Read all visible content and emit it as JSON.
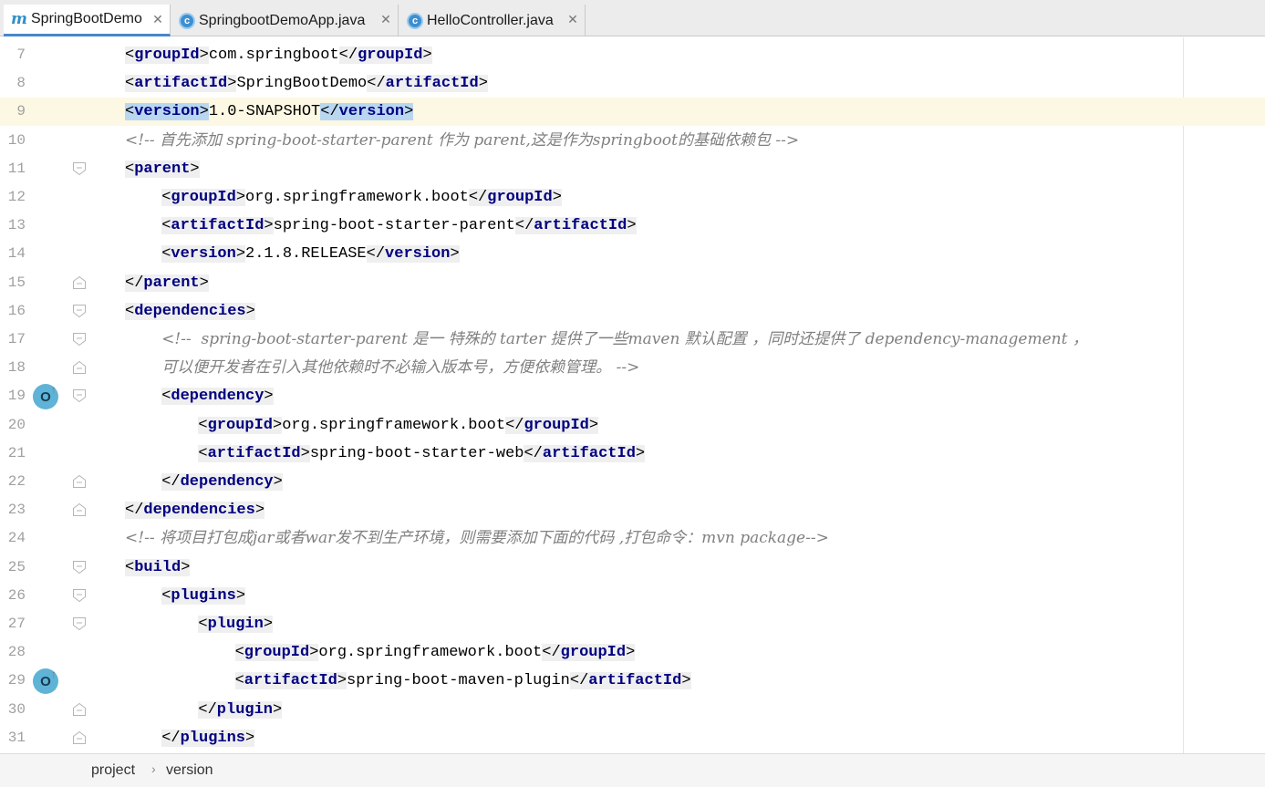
{
  "tabs": [
    {
      "label": "SpringBootDemo",
      "icon": "maven-m-icon",
      "active": true
    },
    {
      "label": "SpringbootDemoApp.java",
      "icon": "java-class-icon",
      "active": false
    },
    {
      "label": "HelloController.java",
      "icon": "java-class-icon",
      "active": false
    }
  ],
  "colors": {
    "tag_name": "#000080",
    "comment": "#808080",
    "current_line": "#fcf8e3",
    "tag_highlight": "#b9d7f1",
    "line_number": "#a0a0a0",
    "tab_underline": "#4a86c8"
  },
  "editor": {
    "current_line": 9,
    "lines": [
      {
        "n": "7",
        "segs": [
          [
            "o",
            "<"
          ],
          [
            "t",
            "groupId"
          ],
          [
            "o",
            ">"
          ],
          [
            "x",
            "com.springboot"
          ],
          [
            "o",
            "</"
          ],
          [
            "t",
            "groupId"
          ],
          [
            "o",
            ">"
          ]
        ]
      },
      {
        "n": "8",
        "segs": [
          [
            "o",
            "<"
          ],
          [
            "t",
            "artifactId"
          ],
          [
            "o",
            ">"
          ],
          [
            "x",
            "SpringBootDemo"
          ],
          [
            "o",
            "</"
          ],
          [
            "t",
            "artifactId"
          ],
          [
            "o",
            ">"
          ]
        ]
      },
      {
        "n": "9",
        "segs": [
          [
            "o",
            "<"
          ],
          [
            "t",
            "version"
          ],
          [
            "o",
            ">"
          ],
          [
            "x",
            "1.0-SNAPSHOT"
          ],
          [
            "o",
            "</"
          ],
          [
            "t",
            "version"
          ],
          [
            "o",
            ">"
          ]
        ]
      },
      {
        "n": "10",
        "segs": [
          [
            "c",
            "<!-- 首先添加 spring-boot-starter-parent 作为 parent,这是作为springboot的基础依赖包 -->"
          ]
        ]
      },
      {
        "n": "11",
        "segs": [
          [
            "o",
            "<"
          ],
          [
            "t",
            "parent"
          ],
          [
            "o",
            ">"
          ]
        ]
      },
      {
        "n": "12",
        "segs": [
          [
            "o",
            "<"
          ],
          [
            "t",
            "groupId"
          ],
          [
            "o",
            ">"
          ],
          [
            "x",
            "org.springframework.boot"
          ],
          [
            "o",
            "</"
          ],
          [
            "t",
            "groupId"
          ],
          [
            "o",
            ">"
          ]
        ]
      },
      {
        "n": "13",
        "segs": [
          [
            "o",
            "<"
          ],
          [
            "t",
            "artifactId"
          ],
          [
            "o",
            ">"
          ],
          [
            "x",
            "spring-boot-starter-parent"
          ],
          [
            "o",
            "</"
          ],
          [
            "t",
            "artifactId"
          ],
          [
            "o",
            ">"
          ]
        ]
      },
      {
        "n": "14",
        "segs": [
          [
            "o",
            "<"
          ],
          [
            "t",
            "version"
          ],
          [
            "o",
            ">"
          ],
          [
            "x",
            "2.1.8.RELEASE"
          ],
          [
            "o",
            "</"
          ],
          [
            "t",
            "version"
          ],
          [
            "o",
            ">"
          ]
        ]
      },
      {
        "n": "15",
        "segs": [
          [
            "o",
            "</"
          ],
          [
            "t",
            "parent"
          ],
          [
            "o",
            ">"
          ]
        ]
      },
      {
        "n": "16",
        "segs": [
          [
            "o",
            "<"
          ],
          [
            "t",
            "dependencies"
          ],
          [
            "o",
            ">"
          ]
        ]
      },
      {
        "n": "17",
        "segs": [
          [
            "c",
            "<!--  spring-boot-starter-parent 是一 特殊的 tarter 提供了一些maven 默认配置 ，同时还提供了 dependency-management ，"
          ]
        ]
      },
      {
        "n": "18",
        "segs": [
          [
            "c",
            "可以便开发者在引入其他依赖时不必输入版本号，方便依赖管理。 -->"
          ]
        ]
      },
      {
        "n": "19",
        "segs": [
          [
            "o",
            "<"
          ],
          [
            "t",
            "dependency"
          ],
          [
            "o",
            ">"
          ]
        ]
      },
      {
        "n": "20",
        "segs": [
          [
            "o",
            "<"
          ],
          [
            "t",
            "groupId"
          ],
          [
            "o",
            ">"
          ],
          [
            "x",
            "org.springframework.boot"
          ],
          [
            "o",
            "</"
          ],
          [
            "t",
            "groupId"
          ],
          [
            "o",
            ">"
          ]
        ]
      },
      {
        "n": "21",
        "segs": [
          [
            "o",
            "<"
          ],
          [
            "t",
            "artifactId"
          ],
          [
            "o",
            ">"
          ],
          [
            "x",
            "spring-boot-starter-web"
          ],
          [
            "o",
            "</"
          ],
          [
            "t",
            "artifactId"
          ],
          [
            "o",
            ">"
          ]
        ]
      },
      {
        "n": "22",
        "segs": [
          [
            "o",
            "</"
          ],
          [
            "t",
            "dependency"
          ],
          [
            "o",
            ">"
          ]
        ]
      },
      {
        "n": "23",
        "segs": [
          [
            "o",
            "</"
          ],
          [
            "t",
            "dependencies"
          ],
          [
            "o",
            ">"
          ]
        ]
      },
      {
        "n": "24",
        "segs": [
          [
            "c",
            "<!-- 将项目打包成jar或者war发不到生产环境，则需要添加下面的代码 ,打包命令：mvn package-->"
          ]
        ]
      },
      {
        "n": "25",
        "segs": [
          [
            "o",
            "<"
          ],
          [
            "t",
            "build"
          ],
          [
            "o",
            ">"
          ]
        ]
      },
      {
        "n": "26",
        "segs": [
          [
            "o",
            "<"
          ],
          [
            "t",
            "plugins"
          ],
          [
            "o",
            ">"
          ]
        ]
      },
      {
        "n": "27",
        "segs": [
          [
            "o",
            "<"
          ],
          [
            "t",
            "plugin"
          ],
          [
            "o",
            ">"
          ]
        ]
      },
      {
        "n": "28",
        "segs": [
          [
            "o",
            "<"
          ],
          [
            "t",
            "groupId"
          ],
          [
            "o",
            ">"
          ],
          [
            "x",
            "org.springframework.boot"
          ],
          [
            "o",
            "</"
          ],
          [
            "t",
            "groupId"
          ],
          [
            "o",
            ">"
          ]
        ]
      },
      {
        "n": "29",
        "segs": [
          [
            "o",
            "<"
          ],
          [
            "t",
            "artifactId"
          ],
          [
            "o",
            ">"
          ],
          [
            "x",
            "spring-boot-maven-plugin"
          ],
          [
            "o",
            "</"
          ],
          [
            "t",
            "artifactId"
          ],
          [
            "o",
            ">"
          ]
        ]
      },
      {
        "n": "30",
        "segs": [
          [
            "o",
            "</"
          ],
          [
            "t",
            "plugin"
          ],
          [
            "o",
            ">"
          ]
        ]
      },
      {
        "n": "31",
        "segs": [
          [
            "o",
            "</"
          ],
          [
            "t",
            "plugins"
          ],
          [
            "o",
            ">"
          ]
        ]
      }
    ]
  },
  "gutter_icons": [
    {
      "line": "19",
      "icon": "override-o-up-icon",
      "glyph": "O"
    },
    {
      "line": "29",
      "icon": "override-o-up-icon",
      "glyph": "O"
    }
  ],
  "breadcrumb": [
    "project",
    "version"
  ]
}
